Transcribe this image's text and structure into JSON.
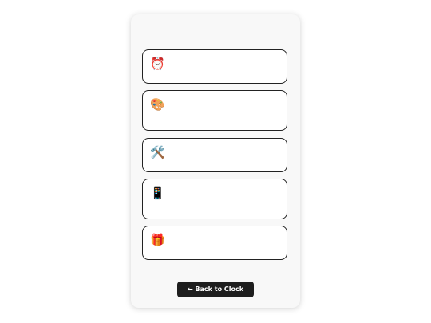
{
  "cards": [
    {
      "icon": "⏰",
      "icon_name": "alarm-clock-icon"
    },
    {
      "icon": "🎨",
      "icon_name": "palette-icon"
    },
    {
      "icon": "🛠️",
      "icon_name": "tools-icon"
    },
    {
      "icon": "📱",
      "icon_name": "mobile-phone-icon"
    },
    {
      "icon": "🎁",
      "icon_name": "gift-icon"
    }
  ],
  "back_button": {
    "label": "← Back to Clock"
  },
  "colors": {
    "button_bg": "#1e1e1e",
    "card_border": "#222222",
    "panel_bg": "#f8f8f8"
  }
}
